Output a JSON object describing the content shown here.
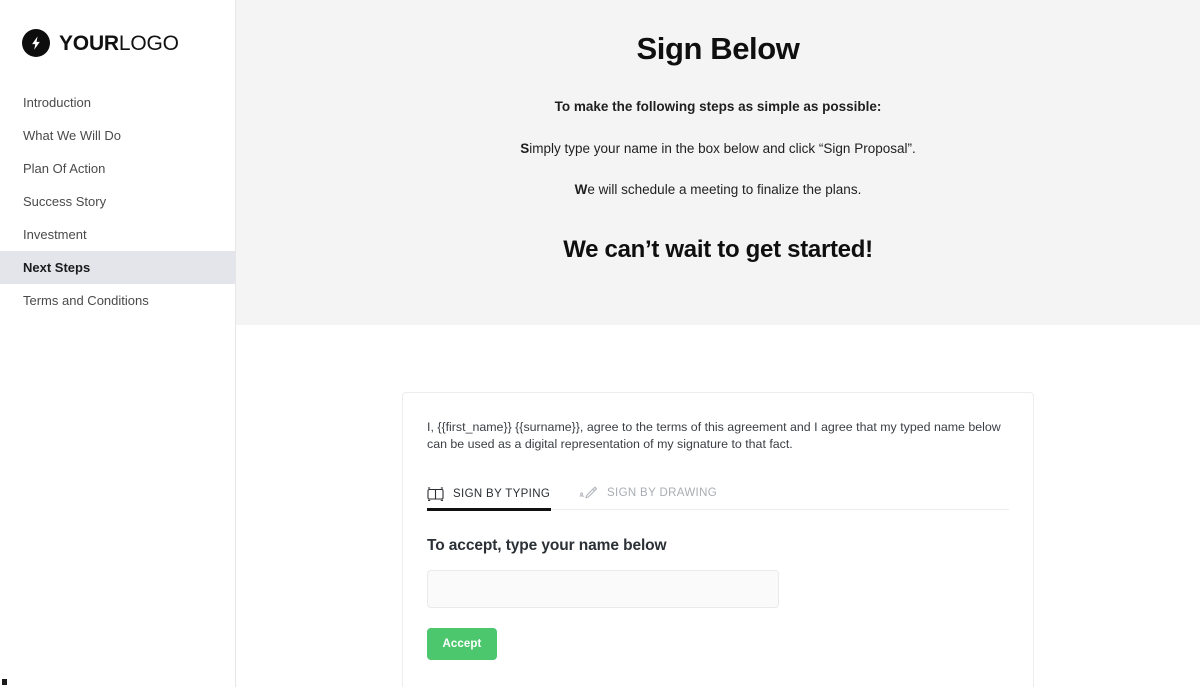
{
  "sidebar": {
    "logo": {
      "icon": "lightning-bolt-icon",
      "bold_part": "YOUR",
      "light_part": "LOGO"
    },
    "items": [
      {
        "label": "Introduction",
        "active": false
      },
      {
        "label": "What We Will Do",
        "active": false
      },
      {
        "label": "Plan Of Action",
        "active": false
      },
      {
        "label": "Success Story",
        "active": false
      },
      {
        "label": "Investment",
        "active": false
      },
      {
        "label": "Next Steps",
        "active": true
      },
      {
        "label": "Terms and Conditions",
        "active": false
      }
    ],
    "active_item": "Next Steps"
  },
  "hero": {
    "title": "Sign Below",
    "line1": "To make the following steps as simple as possible:",
    "line2_lead": "S",
    "line2_rest": "imply type your name in the box below and click “Sign Proposal”.",
    "line3_lead": "W",
    "line3_rest": "e will schedule a meeting to finalize the plans.",
    "closing": "We can’t wait to get started!"
  },
  "signature_card": {
    "consent_text": "I, {{first_name}} {{surname}}, agree to the terms of this agreement and I agree that my typed name below can be used as a digital representation of my signature to that fact.",
    "tabs": [
      {
        "label": "SIGN BY TYPING",
        "icon": "keyboard-icon",
        "active": true
      },
      {
        "label": "SIGN BY DRAWING",
        "icon": "pen-signature-icon",
        "active": false
      }
    ],
    "accept_heading": "To accept, type your name below",
    "name_input": {
      "value": "",
      "placeholder": ""
    },
    "accept_button": "Accept"
  },
  "colors": {
    "accent_green": "#4cc76d",
    "hero_background": "#f4f4f4",
    "active_nav_background": "#e3e5eb",
    "text_primary": "#111111",
    "tab_inactive": "#a9adb2"
  }
}
